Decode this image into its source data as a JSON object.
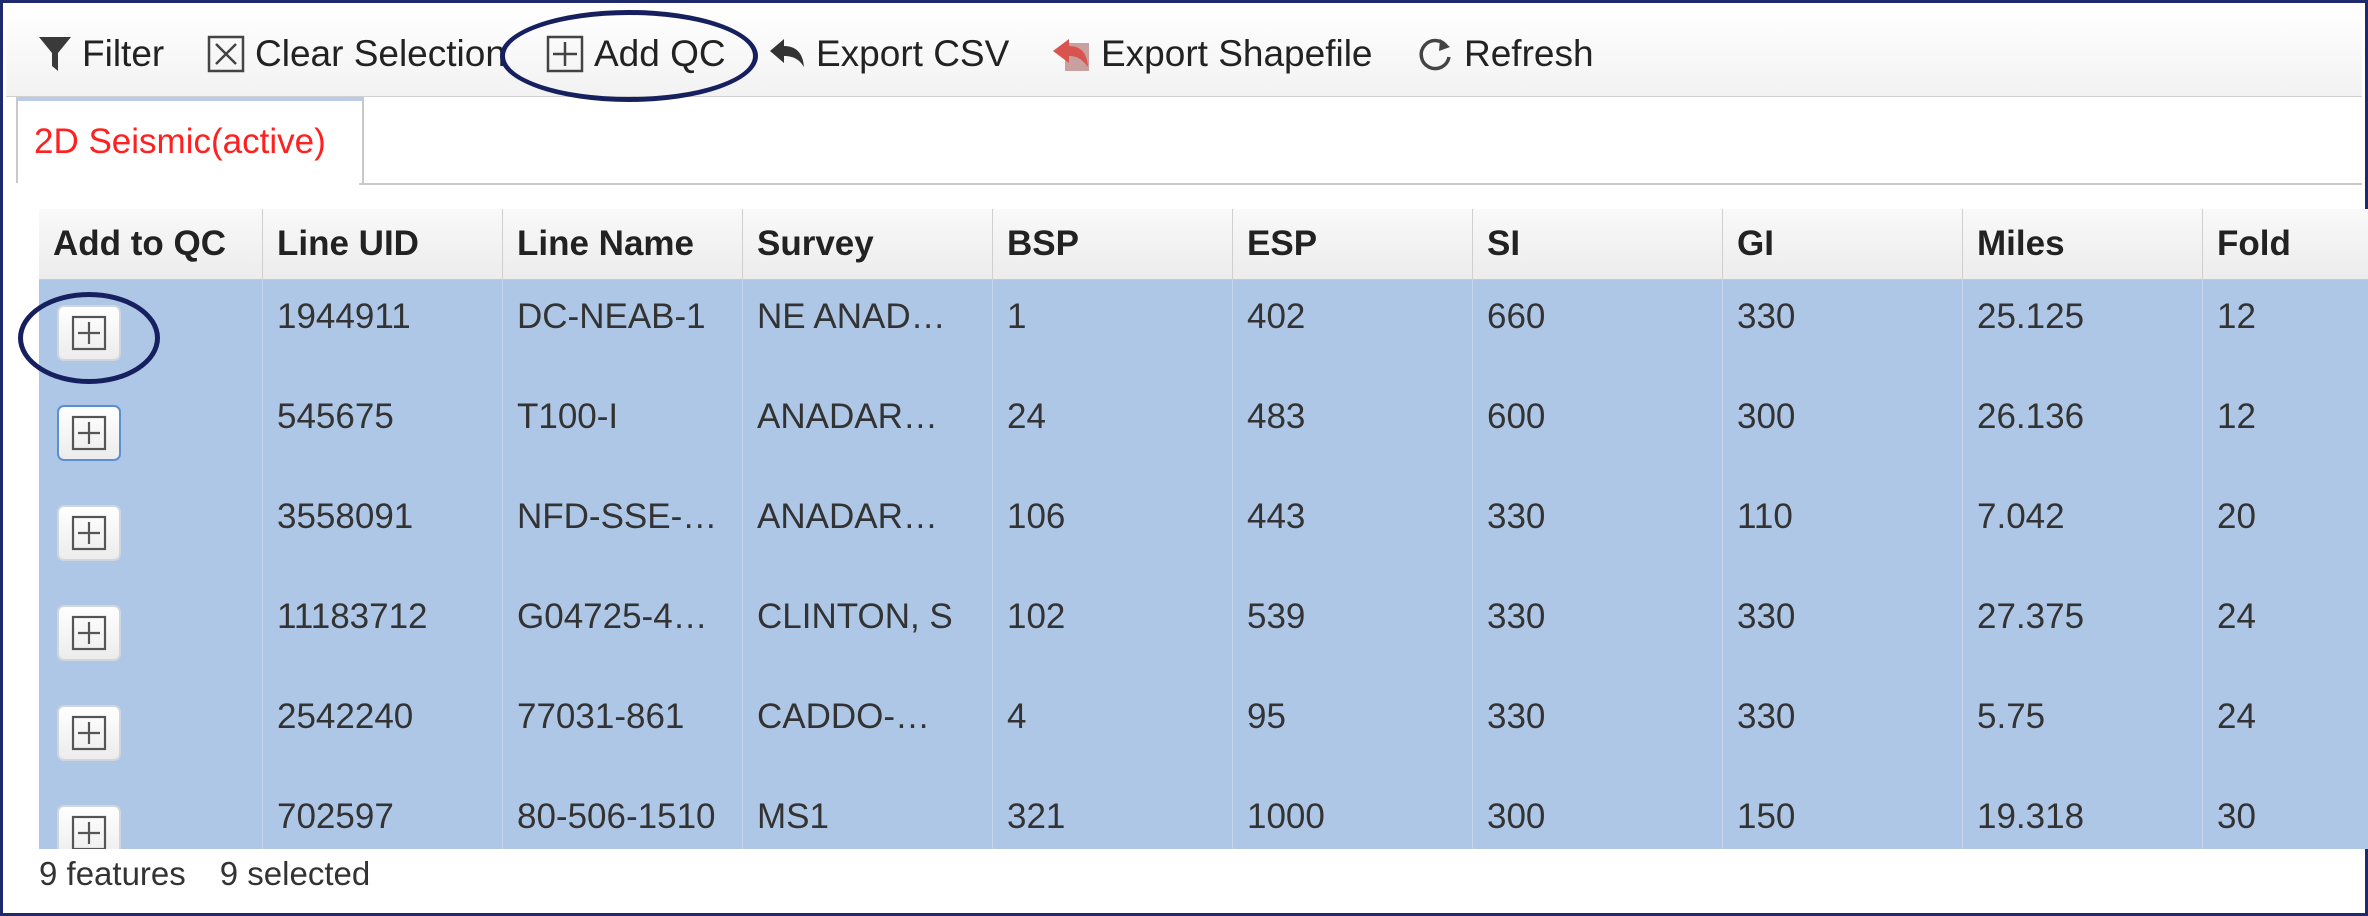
{
  "toolbar": {
    "filter": {
      "label": "Filter",
      "icon": "filter-icon"
    },
    "clear_selection": {
      "label": "Clear Selection",
      "icon": "clear-x-box-icon"
    },
    "add_qc": {
      "label": "Add QC",
      "icon": "plus-box-icon"
    },
    "export_csv": {
      "label": "Export CSV",
      "icon": "reply-arrow-icon"
    },
    "export_shapefile": {
      "label": "Export Shapefile",
      "icon": "export-shapefile-icon"
    },
    "refresh": {
      "label": "Refresh",
      "icon": "refresh-icon"
    }
  },
  "tabs": [
    {
      "label": "2D Seismic(active)",
      "color": "#ff2020"
    }
  ],
  "grid": {
    "columns": [
      "Add to QC",
      "Line UID",
      "Line Name",
      "Survey",
      "BSP",
      "ESP",
      "SI",
      "GI",
      "Miles",
      "Fold"
    ],
    "rows": [
      [
        "1944911",
        "DC-NEAB-1",
        "NE ANAD…",
        "1",
        "402",
        "660",
        "330",
        "25.125",
        "12"
      ],
      [
        "545675",
        "T100-I",
        "ANADAR…",
        "24",
        "483",
        "600",
        "300",
        "26.136",
        "12"
      ],
      [
        "3558091",
        "NFD-SSE-…",
        "ANADAR…",
        "106",
        "443",
        "330",
        "110",
        "7.042",
        "20"
      ],
      [
        "11183712",
        "G04725-4…",
        "CLINTON, S",
        "102",
        "539",
        "330",
        "330",
        "27.375",
        "24"
      ],
      [
        "2542240",
        "77031-861",
        "CADDO-…",
        "4",
        "95",
        "330",
        "330",
        "5.75",
        "24"
      ],
      [
        "702597",
        "80-506-1510",
        "MS1",
        "321",
        "1000",
        "300",
        "150",
        "19.318",
        "30"
      ]
    ],
    "selected_row_color": "#afc7e6"
  },
  "status": {
    "features": "9 features",
    "selected": "9 selected"
  },
  "annotation_color": "#16205e"
}
